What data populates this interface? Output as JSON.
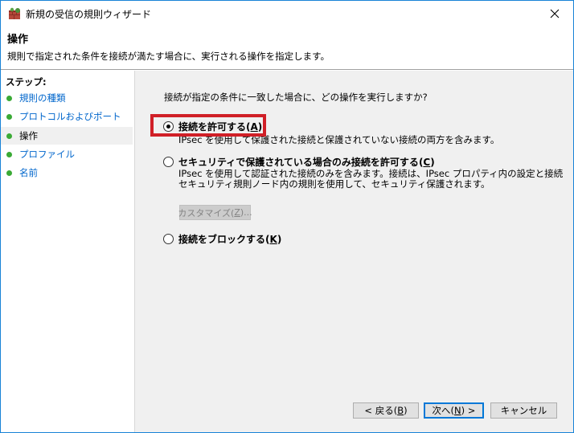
{
  "window": {
    "title": "新規の受信の規則ウィザード"
  },
  "header": {
    "title": "操作",
    "description": "規則で指定された条件を接続が満たす場合に、実行される操作を指定します。"
  },
  "steps": {
    "label": "ステップ:",
    "items": [
      {
        "label": "規則の種類",
        "active": false
      },
      {
        "label": "プロトコルおよびポート",
        "active": false
      },
      {
        "label": "操作",
        "active": true
      },
      {
        "label": "プロファイル",
        "active": false
      },
      {
        "label": "名前",
        "active": false
      }
    ]
  },
  "content": {
    "question": "接続が指定の条件に一致した場合に、どの操作を実行しますか?",
    "options": [
      {
        "label": "接続を許可する",
        "accel": "A",
        "selected": true,
        "desc": [
          "IPsec を使用して保護された接続と保護されていない接続の両方を含みます。"
        ]
      },
      {
        "label": "セキュリティで保護されている場合のみ接続を許可する",
        "accel": "C",
        "selected": false,
        "desc": [
          "IPsec を使用して認証された接続のみを含みます。接続は、IPsec プロパティ内の設定と接続",
          "セキュリティ規則ノード内の規則を使用して、セキュリティ保護されます。"
        ]
      },
      {
        "label": "接続をブロックする",
        "accel": "K",
        "selected": false,
        "desc": []
      }
    ],
    "customize": {
      "label": "カスタマイズ(",
      "accel": "Z",
      "suffix": ")..."
    }
  },
  "buttons": {
    "back": {
      "label": "< 戻る(",
      "accel": "B",
      "suffix": ")"
    },
    "next": {
      "label": "次へ(",
      "accel": "N",
      "suffix": ") >"
    },
    "cancel": {
      "label": "キャンセル"
    }
  },
  "colors": {
    "accent": "#0078d7",
    "highlight": "#d01f27",
    "step_dot": "#3aaa35",
    "link": "#0066cc"
  }
}
